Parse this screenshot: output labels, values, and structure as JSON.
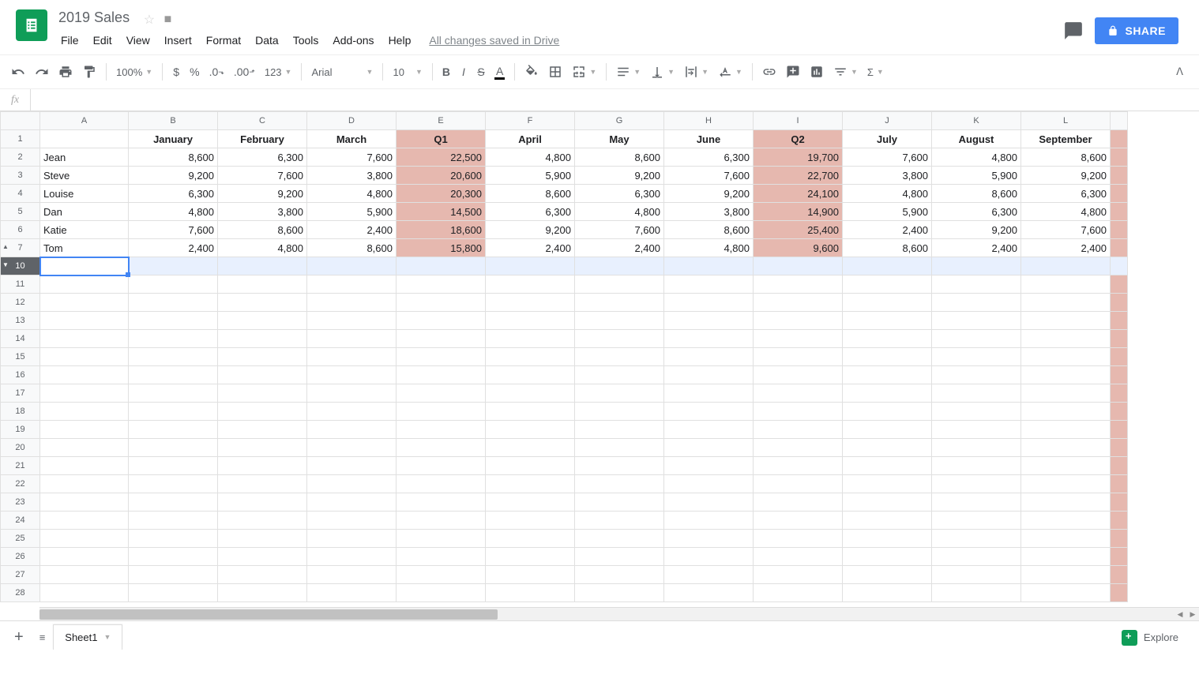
{
  "doc": {
    "title": "2019 Sales",
    "save_status": "All changes saved in Drive"
  },
  "menus": [
    "File",
    "Edit",
    "View",
    "Insert",
    "Format",
    "Data",
    "Tools",
    "Add-ons",
    "Help"
  ],
  "share_label": "SHARE",
  "toolbar": {
    "zoom": "100%",
    "number_format": "123",
    "font": "Arial",
    "font_size": "10"
  },
  "formula_bar": {
    "value": ""
  },
  "columns": [
    "A",
    "B",
    "C",
    "D",
    "E",
    "F",
    "G",
    "H",
    "I",
    "J",
    "K",
    "L"
  ],
  "headers": {
    "A": "",
    "B": "January",
    "C": "February",
    "D": "March",
    "E": "Q1",
    "F": "April",
    "G": "May",
    "H": "June",
    "I": "Q2",
    "J": "July",
    "K": "August",
    "L": "September"
  },
  "highlight_cols": [
    "E",
    "I"
  ],
  "rows": [
    {
      "n": "2",
      "name": "Jean",
      "B": "8,600",
      "C": "6,300",
      "D": "7,600",
      "E": "22,500",
      "F": "4,800",
      "G": "8,600",
      "H": "6,300",
      "I": "19,700",
      "J": "7,600",
      "K": "4,800",
      "L": "8,600"
    },
    {
      "n": "3",
      "name": "Steve",
      "B": "9,200",
      "C": "7,600",
      "D": "3,800",
      "E": "20,600",
      "F": "5,900",
      "G": "9,200",
      "H": "7,600",
      "I": "22,700",
      "J": "3,800",
      "K": "5,900",
      "L": "9,200"
    },
    {
      "n": "4",
      "name": "Louise",
      "B": "6,300",
      "C": "9,200",
      "D": "4,800",
      "E": "20,300",
      "F": "8,600",
      "G": "6,300",
      "H": "9,200",
      "I": "24,100",
      "J": "4,800",
      "K": "8,600",
      "L": "6,300"
    },
    {
      "n": "5",
      "name": "Dan",
      "B": "4,800",
      "C": "3,800",
      "D": "5,900",
      "E": "14,500",
      "F": "6,300",
      "G": "4,800",
      "H": "3,800",
      "I": "14,900",
      "J": "5,900",
      "K": "6,300",
      "L": "4,800"
    },
    {
      "n": "6",
      "name": "Katie",
      "B": "7,600",
      "C": "8,600",
      "D": "2,400",
      "E": "18,600",
      "F": "9,200",
      "G": "7,600",
      "H": "8,600",
      "I": "25,400",
      "J": "2,400",
      "K": "9,200",
      "L": "7,600"
    },
    {
      "n": "7",
      "name": "Tom",
      "B": "2,400",
      "C": "4,800",
      "D": "8,600",
      "E": "15,800",
      "F": "2,400",
      "G": "2,400",
      "H": "4,800",
      "I": "9,600",
      "J": "8,600",
      "K": "2,400",
      "L": "2,400"
    }
  ],
  "empty_rows": [
    "10",
    "11",
    "12",
    "13",
    "14",
    "15",
    "16",
    "17",
    "18",
    "19",
    "20",
    "21",
    "22",
    "23",
    "24",
    "25",
    "26",
    "27",
    "28"
  ],
  "selected_row": "10",
  "sheet_tab": "Sheet1",
  "explore_label": "Explore"
}
